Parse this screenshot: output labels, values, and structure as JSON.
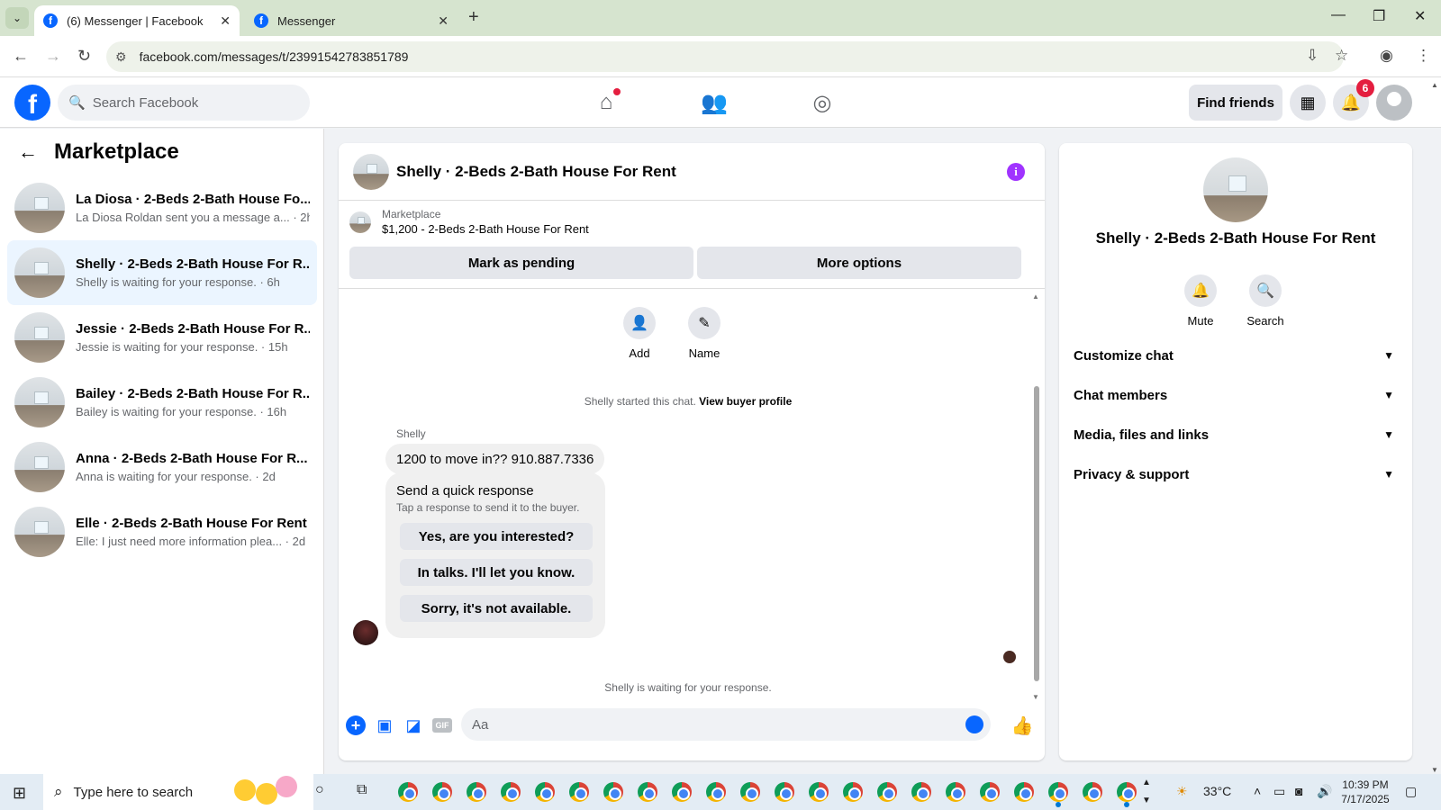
{
  "browser": {
    "tabs": [
      {
        "title": "(6) Messenger | Facebook",
        "active": true
      },
      {
        "title": "Messenger",
        "active": false
      }
    ],
    "url": "facebook.com/messages/t/23991542783851789"
  },
  "fb_header": {
    "search_placeholder": "Search Facebook",
    "find_friends": "Find friends",
    "notification_count": "6"
  },
  "left_panel": {
    "title": "Marketplace",
    "conversations": [
      {
        "name": "La Diosa · 2-Beds 2-Bath House Fo...",
        "preview": "La Diosa Roldan sent you a message a... · 2h"
      },
      {
        "name": "Shelly · 2-Beds 2-Bath House For R...",
        "preview": "Shelly is waiting for your response. · 6h"
      },
      {
        "name": "Jessie · 2-Beds 2-Bath House For R...",
        "preview": "Jessie is waiting for your response. · 15h"
      },
      {
        "name": "Bailey · 2-Beds 2-Bath House For R...",
        "preview": "Bailey is waiting for your response. · 16h"
      },
      {
        "name": "Anna · 2-Beds 2-Bath House For R...",
        "preview": "Anna is waiting for your response. · 2d"
      },
      {
        "name": "Elle · 2-Beds 2-Bath House For Rent",
        "preview": "Elle: I just need more information plea... · 2d"
      }
    ]
  },
  "chat": {
    "title": "Shelly · 2-Beds 2-Bath House For Rent",
    "listing_label": "Marketplace",
    "listing_title": "$1,200 - 2-Beds 2-Bath House For Rent",
    "mark_pending": "Mark as pending",
    "more_options": "More options",
    "add_label": "Add",
    "name_label": "Name",
    "started_text": "Shelly started this chat.",
    "view_buyer_profile": "View buyer profile",
    "sender": "Shelly",
    "message": "1200 to move in?? 910.887.7336",
    "quick_response_title": "Send a quick response",
    "quick_response_sub": "Tap a response to send it to the buyer.",
    "quick_options": [
      "Yes, are you interested?",
      "In talks. I'll let you know.",
      "Sorry, it's not available."
    ],
    "waiting_text": "Shelly is waiting for your response.",
    "composer_placeholder": "Aa",
    "gif_label": "GIF"
  },
  "right_panel": {
    "name": "Shelly · 2-Beds 2-Bath House For Rent",
    "mute": "Mute",
    "search": "Search",
    "sections": [
      "Customize chat",
      "Chat members",
      "Media, files and links",
      "Privacy & support"
    ]
  },
  "taskbar": {
    "search_placeholder": "Type here to search",
    "temperature": "33°C",
    "time": "10:39 PM",
    "date": "7/17/2025"
  }
}
